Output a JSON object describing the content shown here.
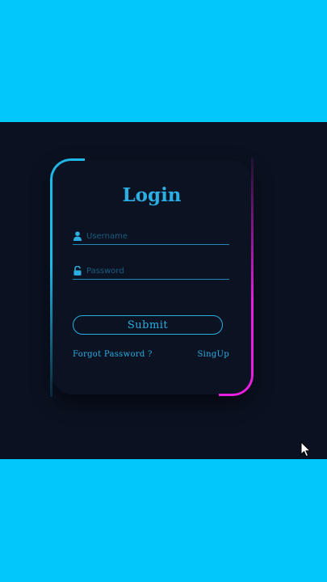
{
  "login": {
    "title": "Login",
    "username_placeholder": "Username",
    "password_placeholder": "Password",
    "submit_label": "Submit",
    "forgot_label": "Forgot Password ?",
    "signup_label": "SingUp"
  },
  "icons": {
    "username": "user-icon",
    "password": "unlock-icon",
    "cursor": "mouse-pointer-icon"
  },
  "colors": {
    "page_background": "#00c8fb",
    "stage_background": "#0a1120",
    "card_background": "#0b1322",
    "accent_cyan": "#2aaee3",
    "glow_cyan": "#1fb6e8",
    "glow_magenta": "#e81ee0"
  }
}
